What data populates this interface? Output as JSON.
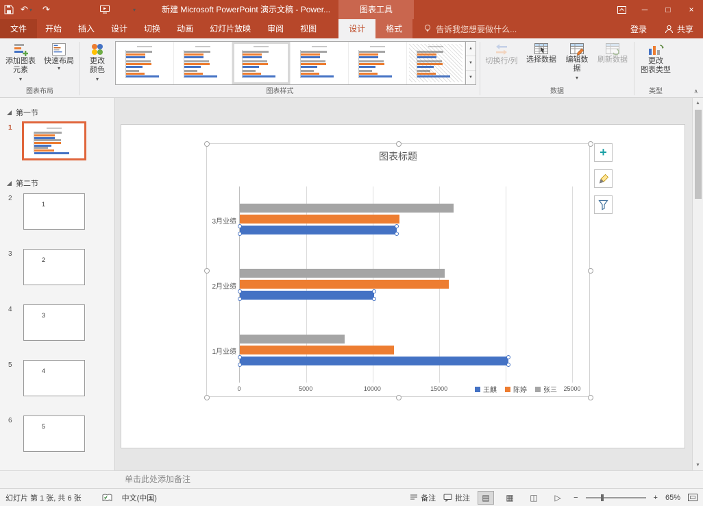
{
  "colors": {
    "accent": "#B7472A",
    "contextual_highlight": "#C9664E",
    "series_blue": "#4472C4",
    "series_orange": "#ED7D31",
    "series_gray": "#A5A5A5",
    "selected_slide_border": "#E0663C"
  },
  "title_bar": {
    "title": "新建 Microsoft PowerPoint 演示文稿 - Power...",
    "context_tool": "图表工具"
  },
  "tabs": {
    "file": "文件",
    "main": [
      "开始",
      "插入",
      "设计",
      "切换",
      "动画",
      "幻灯片放映",
      "审阅",
      "视图"
    ],
    "contextual": [
      "设计",
      "格式"
    ],
    "active_contextual": "设计"
  },
  "tellme": "告诉我您想要做什么...",
  "account": {
    "sign_in": "登录",
    "share": "共享"
  },
  "ribbon": {
    "groups": {
      "chart_layout": {
        "label": "图表布局",
        "add_element": "添加图表\n元素",
        "quick_layout": "快速布局"
      },
      "chart_styles": {
        "label": "图表样式",
        "change_colors": "更改\n颜色",
        "styles_count": 6,
        "selected_style": 3
      },
      "data": {
        "label": "数据",
        "switch_row_col": "切换行/列",
        "select_data": "选择数据",
        "edit_data": "编辑数\n据",
        "refresh_data": "刷新数据"
      },
      "type": {
        "label": "类型",
        "change_chart_type": "更改\n图表类型"
      }
    }
  },
  "slides_panel": {
    "sections": [
      {
        "name": "第一节",
        "slides": [
          {
            "number": "1",
            "selected": true,
            "kind": "chart"
          }
        ]
      },
      {
        "name": "第二节",
        "slides": [
          {
            "number": "2",
            "text": "1"
          },
          {
            "number": "3",
            "text": "2"
          },
          {
            "number": "4",
            "text": "3"
          },
          {
            "number": "5",
            "text": "4"
          },
          {
            "number": "6",
            "text": "5"
          }
        ]
      }
    ]
  },
  "chart_data": {
    "type": "bar",
    "orientation": "horizontal",
    "title": "图表标题",
    "categories": [
      "1月业绩",
      "2月业绩",
      "3月业绩"
    ],
    "series": [
      {
        "name": "王麒",
        "color": "#4472C4",
        "values": [
          20200,
          10100,
          11800
        ]
      },
      {
        "name": "陈婷",
        "color": "#ED7D31",
        "values": [
          11600,
          15700,
          12000
        ]
      },
      {
        "name": "张三",
        "color": "#A5A5A5",
        "values": [
          7900,
          15400,
          16100
        ]
      }
    ],
    "xlim": [
      0,
      25000
    ],
    "xticks": [
      "0",
      "5000",
      "10000",
      "15000",
      "20000",
      "25000"
    ],
    "legend_position": "bottom",
    "gridlines": true,
    "selected_series": "王麒"
  },
  "notes": {
    "placeholder": "单击此处添加备注"
  },
  "status_bar": {
    "slide_info": "幻灯片 第 1 张, 共 6 张",
    "language": "中文(中国)",
    "notes_button": "备注",
    "comments_button": "批注",
    "zoom_level": "65%"
  },
  "icons": {
    "caret_down": "▾",
    "undo": "↶",
    "redo": "↷",
    "window_minimize": "─",
    "window_maximize": "□",
    "window_close": "×",
    "gallery_up": "▲",
    "gallery_down": "▼",
    "gallery_more": "▼",
    "ribbon_collapse": "∧",
    "scroll_up": "▲",
    "scroll_down": "▼",
    "view_normal": "▤",
    "view_sorter": "▦",
    "view_reading": "◫",
    "view_slideshow": "▷",
    "zoom_out": "−",
    "zoom_in": "+",
    "plus_button": "+"
  }
}
